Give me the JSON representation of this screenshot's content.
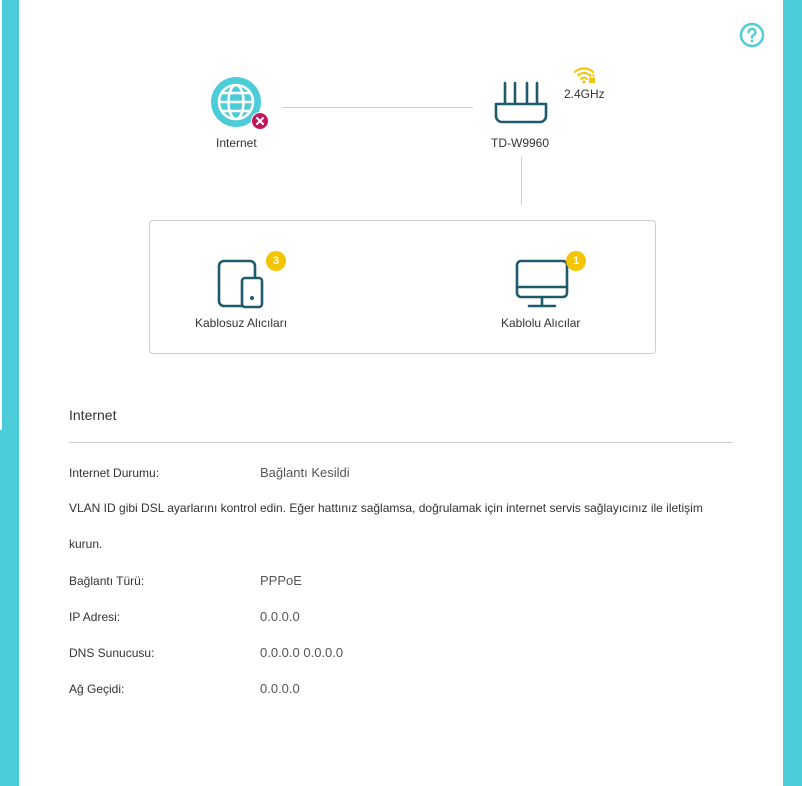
{
  "topology": {
    "internet_label": "Internet",
    "router_label": "TD-W9960",
    "band": "2.4GHz",
    "wireless_clients": {
      "label": "Kablosuz Alıcıları",
      "count": "3"
    },
    "wired_clients": {
      "label": "Kablolu Alıcılar",
      "count": "1"
    }
  },
  "internet_section": {
    "title": "Internet",
    "status_label": "Internet Durumu:",
    "status_value": "Bağlantı Kesildi",
    "note": "VLAN ID gibi DSL ayarlarını kontrol edin. Eğer hattınız sağlamsa, doğrulamak için internet servis sağlayıcınız ile iletişim kurun.",
    "rows": [
      {
        "label": "Bağlantı Türü:",
        "value": "PPPoE"
      },
      {
        "label": "IP Adresi:",
        "value": "0.0.0.0"
      },
      {
        "label": "DNS Sunucusu:",
        "value": "0.0.0.0 0.0.0.0"
      },
      {
        "label": "Ağ Geçidi:",
        "value": "0.0.0.0"
      }
    ]
  },
  "colors": {
    "accent": "#4ccbd8",
    "icon_stroke": "#1d5a6b",
    "error": "#c2185b",
    "badge": "#f5c400"
  }
}
